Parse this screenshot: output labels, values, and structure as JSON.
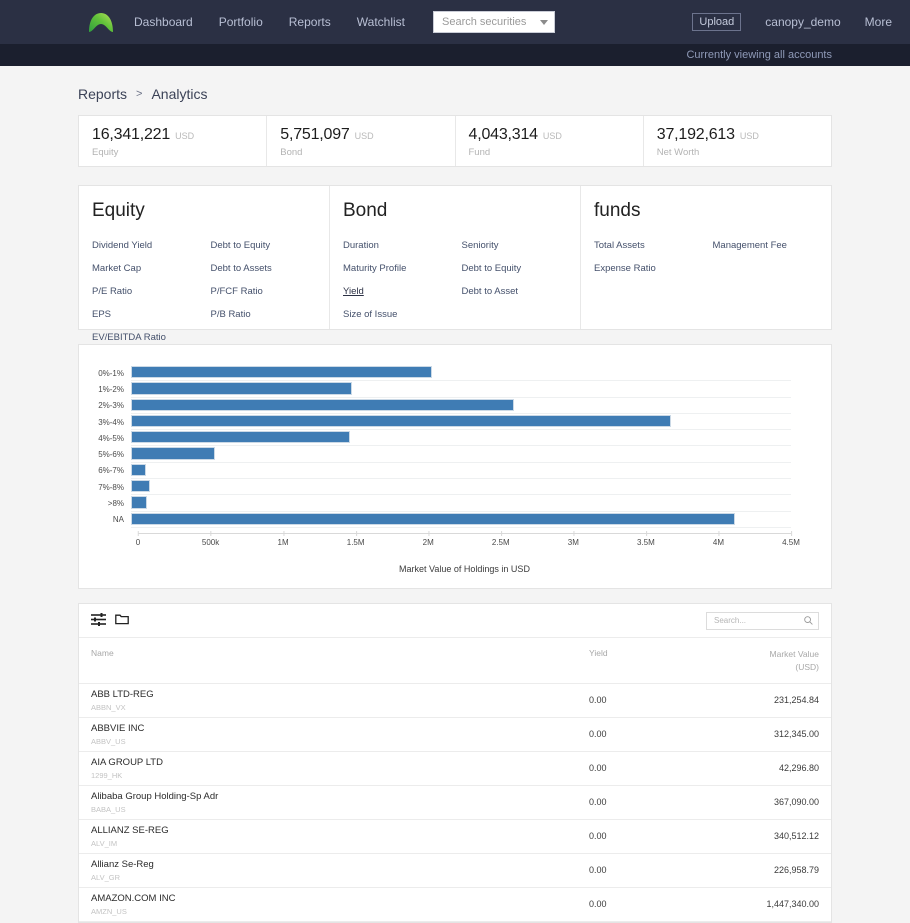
{
  "nav": {
    "logo_name": "canopy-logo",
    "links": [
      "Dashboard",
      "Portfolio",
      "Reports",
      "Watchlist"
    ],
    "search_placeholder": "Search securities",
    "upload_label": "Upload",
    "user_label": "canopy_demo",
    "more_label": "More",
    "account_notice": "Currently viewing all accounts"
  },
  "breadcrumb": {
    "parent": "Reports",
    "separator": ">",
    "current": "Analytics"
  },
  "kpis": [
    {
      "value": "16,341,221",
      "currency": "USD",
      "label": "Equity"
    },
    {
      "value": "5,751,097",
      "currency": "USD",
      "label": "Bond"
    },
    {
      "value": "4,043,314",
      "currency": "USD",
      "label": "Fund"
    },
    {
      "value": "37,192,613",
      "currency": "USD",
      "label": "Net Worth"
    }
  ],
  "panels": [
    {
      "title": "Equity",
      "col1": [
        "Dividend Yield",
        "Market Cap",
        "P/E Ratio",
        "EPS",
        "EV/EBITDA Ratio"
      ],
      "col2": [
        "Debt to Equity",
        "Debt to Assets",
        "P/FCF Ratio",
        "P/B Ratio"
      ],
      "active": ""
    },
    {
      "title": "Bond",
      "col1": [
        "Duration",
        "Maturity Profile",
        "Yield",
        "Size of Issue"
      ],
      "col2": [
        "Seniority",
        "Debt to Equity",
        "Debt to Asset"
      ],
      "active": "Yield"
    },
    {
      "title": "funds",
      "col1": [
        "Total Assets",
        "Expense Ratio"
      ],
      "col2": [
        "Management Fee"
      ],
      "active": ""
    }
  ],
  "chart_data": {
    "type": "bar",
    "orientation": "horizontal",
    "title": "",
    "xlabel": "Market Value of Holdings in USD",
    "ylabel": "",
    "categories": [
      "0%-1%",
      "1%-2%",
      "2%-3%",
      "3%-4%",
      "4%-5%",
      "5%-6%",
      "6%-7%",
      "7%-8%",
      ">8%",
      "NA"
    ],
    "values": [
      2050000,
      1510000,
      2610000,
      3680000,
      1490000,
      570000,
      100000,
      130000,
      110000,
      4120000
    ],
    "xlim": [
      0,
      4500000
    ],
    "xticks": [
      0,
      500000,
      1000000,
      1500000,
      2000000,
      2500000,
      3000000,
      3500000,
      4000000,
      4500000
    ],
    "xticklabels": [
      "0",
      "500k",
      "1M",
      "1.5M",
      "2M",
      "2.5M",
      "3M",
      "3.5M",
      "4M",
      "4.5M"
    ],
    "grid": true,
    "legend": false,
    "bar_color": "#3f7cb4"
  },
  "table": {
    "filter_icon": "sliders-icon",
    "folder_icon": "folder-icon",
    "search_placeholder": "Search...",
    "headers": {
      "name": "Name",
      "yield": "Yield",
      "market_value": "Market Value",
      "market_value_sub": "(USD)"
    },
    "rows": [
      {
        "name": "ABB LTD-REG",
        "ticker": "ABBN_VX",
        "yield": "0.00",
        "market_value": "231,254.84"
      },
      {
        "name": "ABBVIE INC",
        "ticker": "ABBV_US",
        "yield": "0.00",
        "market_value": "312,345.00"
      },
      {
        "name": "AIA GROUP LTD",
        "ticker": "1299_HK",
        "yield": "0.00",
        "market_value": "42,296.80"
      },
      {
        "name": "Alibaba Group Holding-Sp Adr",
        "ticker": "BABA_US",
        "yield": "0.00",
        "market_value": "367,090.00"
      },
      {
        "name": "ALLIANZ SE-REG",
        "ticker": "ALV_IM",
        "yield": "0.00",
        "market_value": "340,512.12"
      },
      {
        "name": "Allianz Se-Reg",
        "ticker": "ALV_GR",
        "yield": "0.00",
        "market_value": "226,958.79"
      },
      {
        "name": "AMAZON.COM INC",
        "ticker": "AMZN_US",
        "yield": "0.00",
        "market_value": "1,447,340.00"
      }
    ]
  }
}
